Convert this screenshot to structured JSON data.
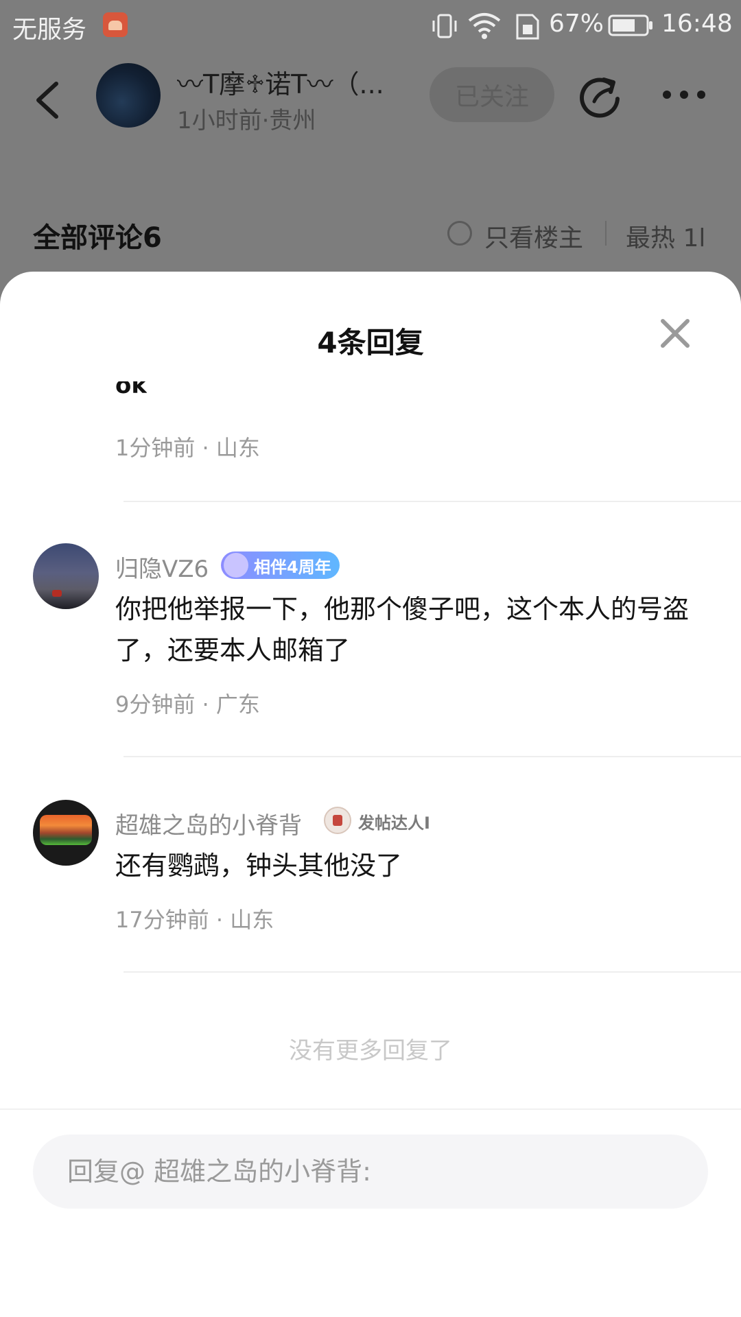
{
  "status_bar": {
    "carrier": "无服务",
    "battery_percent": "67%",
    "time": "16:48"
  },
  "post_header": {
    "author_name": "〰T摩♱诺T〰（...",
    "author_meta": "1小时前·贵州",
    "follow_label": "已关注"
  },
  "comments_bar": {
    "title": "全部评论6",
    "only_op_label": "只看楼主",
    "sort_label": "最热 1l"
  },
  "sheet": {
    "title": "4条回复",
    "partial_reply": {
      "content": "ok",
      "meta": "1分钟前 · 山东"
    },
    "replies": [
      {
        "username": "归隐VZ6",
        "badge": "相伴4周年",
        "content": "你把他举报一下，他那个傻子吧，这个本人的号盗了，还要本人邮箱了",
        "meta": "9分钟前 · 广东"
      },
      {
        "username": "超雄之岛的小脊背",
        "badge": "发帖达人I",
        "content": "还有鹦鹉，钟头其他没了",
        "meta": "17分钟前 · 山东"
      }
    ],
    "no_more_text": "没有更多回复了"
  },
  "reply_input": {
    "placeholder": "回复@ 超雄之岛的小脊背:"
  }
}
